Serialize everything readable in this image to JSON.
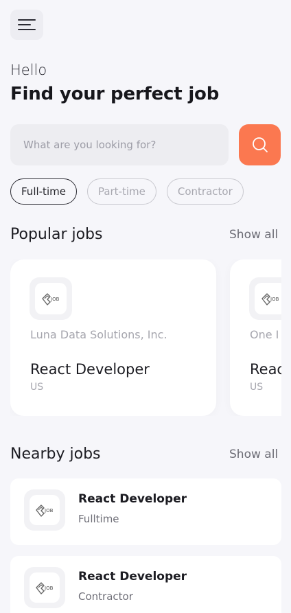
{
  "header": {
    "menu_icon": "hamburger-menu-icon",
    "greeting": "Hello",
    "headline": "Find your perfect job"
  },
  "search": {
    "placeholder": "What are you looking for?",
    "button_icon": "search-icon",
    "accent_color": "#fb7850"
  },
  "filters": [
    {
      "label": "Full-time",
      "active": true
    },
    {
      "label": "Part-time",
      "active": false
    },
    {
      "label": "Contractor",
      "active": false
    }
  ],
  "popular": {
    "title": "Popular jobs",
    "show_all": "Show all",
    "cards": [
      {
        "company": "Luna Data Solutions, Inc.",
        "job_title": "React Developer",
        "location": "US",
        "logo_text": "JOB"
      },
      {
        "company": "One I",
        "job_title": "Reac",
        "location": "US",
        "logo_text": "JOB"
      }
    ]
  },
  "nearby": {
    "title": "Nearby jobs",
    "show_all": "Show all",
    "items": [
      {
        "job_title": "React Developer",
        "job_type": "Fulltime",
        "logo_text": "JOB"
      },
      {
        "job_title": "React Developer",
        "job_type": "Contractor",
        "logo_text": "JOB"
      }
    ]
  }
}
